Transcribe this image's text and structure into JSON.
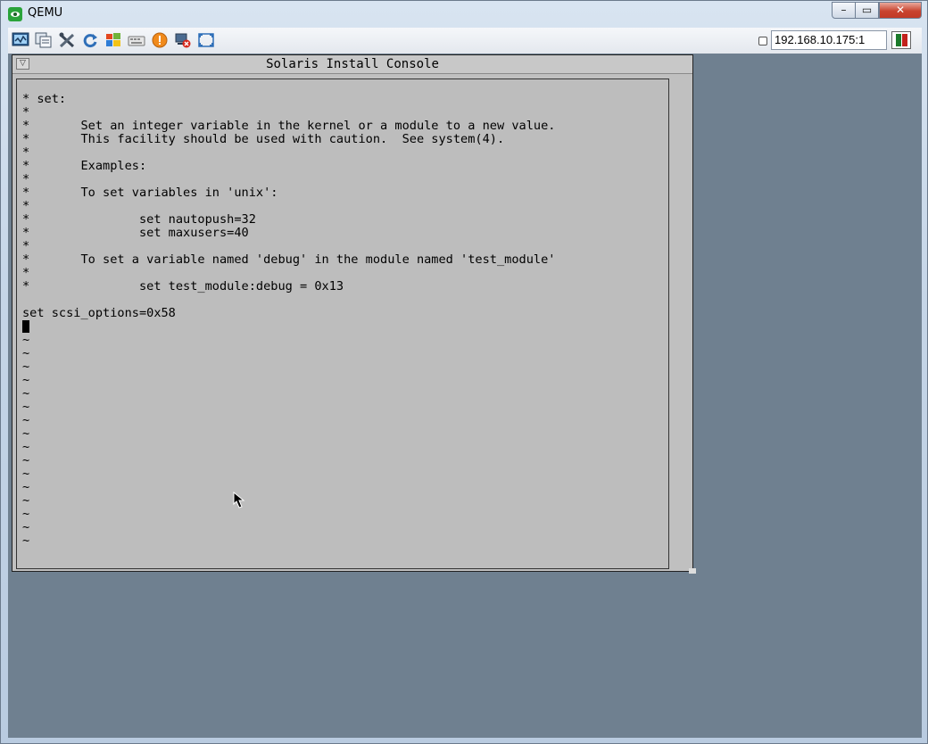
{
  "window": {
    "title": "QEMU"
  },
  "toolbar": {
    "buttons": [
      "monitor-icon",
      "copy-icon",
      "tools-icon",
      "refresh-icon",
      "windows-logo-icon",
      "keyboard-icon",
      "alert-icon",
      "disconnect-icon",
      "fullscreen-icon"
    ],
    "address": "192.168.10.175:1"
  },
  "console": {
    "title": "Solaris Install Console",
    "lines": [
      "* set:",
      "*",
      "*       Set an integer variable in the kernel or a module to a new value.",
      "*       This facility should be used with caution.  See system(4).",
      "*",
      "*       Examples:",
      "*",
      "*       To set variables in 'unix':",
      "*",
      "*               set nautopush=32",
      "*               set maxusers=40",
      "*",
      "*       To set a variable named 'debug' in the module named 'test_module'",
      "*",
      "*               set test_module:debug = 0x13",
      "",
      "set scsi_options=0x58",
      "",
      "~",
      "~",
      "~",
      "~",
      "~",
      "~",
      "~",
      "~",
      "~",
      "~",
      "~",
      "~",
      "~",
      "~",
      "~",
      "~"
    ]
  }
}
